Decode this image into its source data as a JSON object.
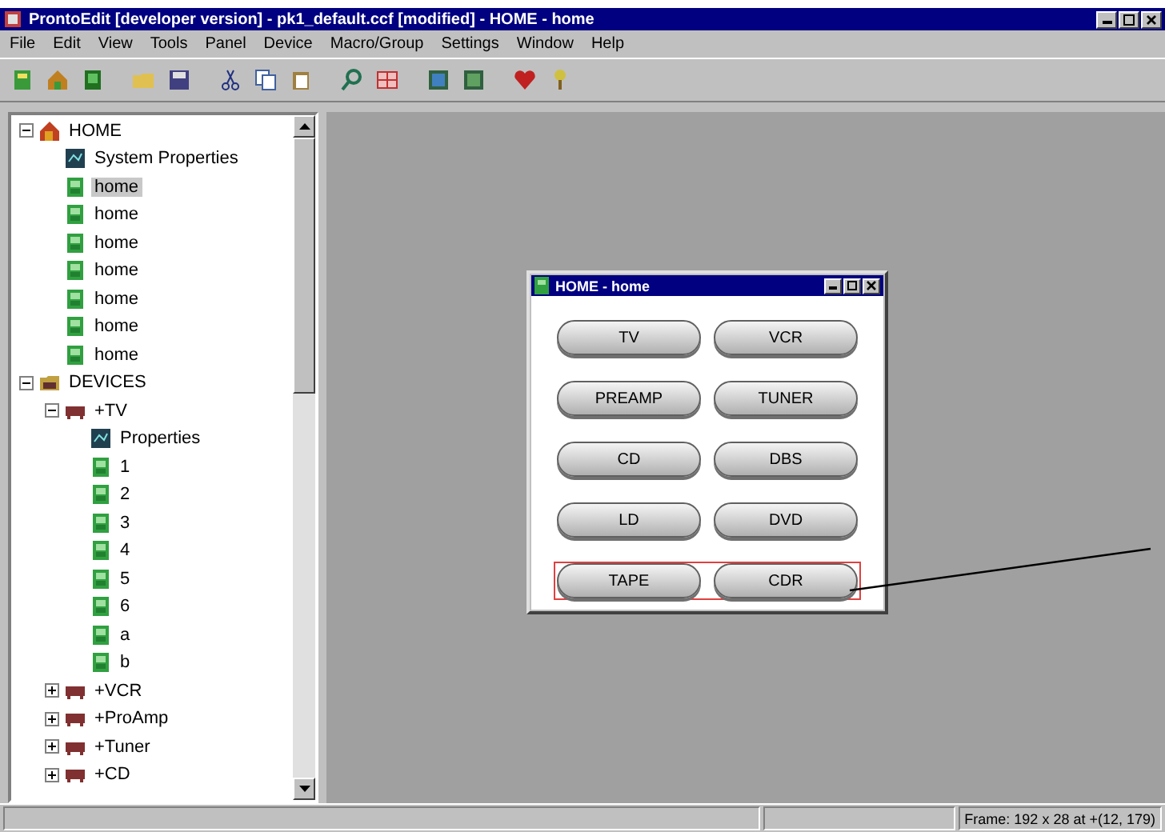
{
  "window": {
    "title": "ProntoEdit [developer version] - pk1_default.ccf [modified] - HOME - home"
  },
  "menu": [
    "File",
    "Edit",
    "View",
    "Tools",
    "Panel",
    "Device",
    "Macro/Group",
    "Settings",
    "Window",
    "Help"
  ],
  "tree": [
    {
      "label": "HOME",
      "kind": "home",
      "expanded": true,
      "selected": false,
      "children": [
        {
          "label": "System Properties",
          "kind": "properties",
          "selected": false
        },
        {
          "label": "home",
          "kind": "panel",
          "selected": true
        },
        {
          "label": "home",
          "kind": "panel",
          "selected": false
        },
        {
          "label": "home",
          "kind": "panel",
          "selected": false
        },
        {
          "label": "home",
          "kind": "panel",
          "selected": false
        },
        {
          "label": "home",
          "kind": "panel",
          "selected": false
        },
        {
          "label": "home",
          "kind": "panel",
          "selected": false
        },
        {
          "label": "home",
          "kind": "panel",
          "selected": false
        }
      ]
    },
    {
      "label": "DEVICES",
      "kind": "devices",
      "expanded": true,
      "selected": false,
      "children": [
        {
          "label": "+TV",
          "kind": "device",
          "expanded": true,
          "selected": false,
          "children": [
            {
              "label": "Properties",
              "kind": "properties",
              "selected": false
            },
            {
              "label": "1",
              "kind": "panel",
              "selected": false
            },
            {
              "label": "2",
              "kind": "panel",
              "selected": false
            },
            {
              "label": "3",
              "kind": "panel",
              "selected": false
            },
            {
              "label": "4",
              "kind": "panel",
              "selected": false
            },
            {
              "label": "5",
              "kind": "panel",
              "selected": false
            },
            {
              "label": "6",
              "kind": "panel",
              "selected": false
            },
            {
              "label": "a",
              "kind": "panel",
              "selected": false
            },
            {
              "label": "b",
              "kind": "panel",
              "selected": false
            }
          ]
        },
        {
          "label": "+VCR",
          "kind": "device",
          "expanded": false,
          "selected": false
        },
        {
          "label": "+ProAmp",
          "kind": "device",
          "expanded": false,
          "selected": false
        },
        {
          "label": "+Tuner",
          "kind": "device",
          "expanded": false,
          "selected": false
        },
        {
          "label": "+CD",
          "kind": "device",
          "expanded": false,
          "selected": false
        }
      ]
    }
  ],
  "panel_window": {
    "title": "HOME - home",
    "rows": [
      {
        "selected": false,
        "buttons": [
          "TV",
          "VCR"
        ]
      },
      {
        "selected": false,
        "buttons": [
          "PREAMP",
          "TUNER"
        ]
      },
      {
        "selected": false,
        "buttons": [
          "CD",
          "DBS"
        ]
      },
      {
        "selected": false,
        "buttons": [
          "LD",
          "DVD"
        ]
      },
      {
        "selected": true,
        "buttons": [
          "TAPE",
          "CDR"
        ]
      }
    ]
  },
  "status_bar": {
    "text": "Frame: 192 x 28 at +(12, 179)"
  }
}
